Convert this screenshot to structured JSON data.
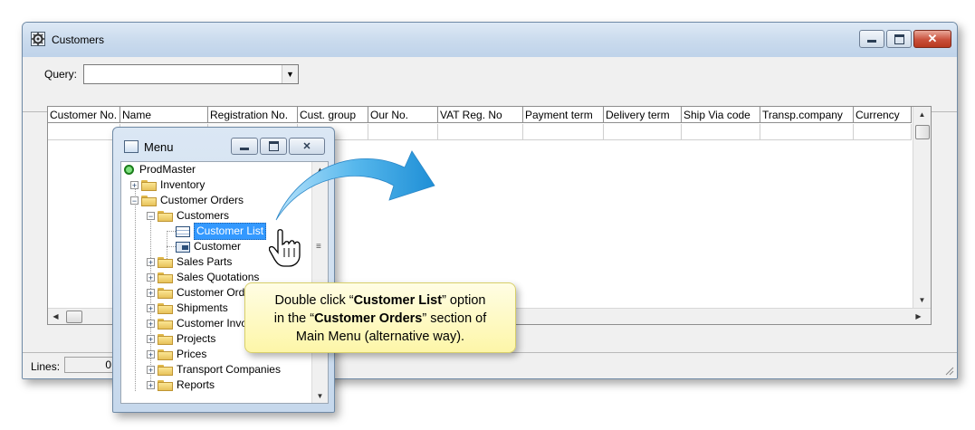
{
  "main_window": {
    "title": "Customers",
    "query_label": "Query:",
    "query_value": "",
    "columns": [
      "Customer No.",
      "Name",
      "Registration No.",
      "Cust. group",
      "Our No.",
      "VAT Reg. No",
      "Payment term",
      "Delivery term",
      "Ship Via code",
      "Transp.company",
      "Currency"
    ],
    "status": {
      "lines_label": "Lines:",
      "lines_value": "0"
    }
  },
  "menu_window": {
    "title": "Menu",
    "tree": {
      "root": "ProdMaster",
      "inventory": "Inventory",
      "customer_orders": "Customer Orders",
      "customers": "Customers",
      "customer_list": "Customer List",
      "customer": "Customer",
      "sales_parts": "Sales Parts",
      "sales_quotations": "Sales Quotations",
      "customer_orders_child": "Customer Orders",
      "shipments": "Shipments",
      "customer_invoices": "Customer Invoices",
      "projects": "Projects",
      "prices": "Prices",
      "transport_companies": "Transport Companies",
      "reports": "Reports"
    }
  },
  "callout": {
    "part1": "Double click “",
    "bold1": "Customer List",
    "part2": "” option",
    "part3": "in the “",
    "bold2": "Customer Orders",
    "part4": "” section of",
    "line3": "Main Menu (alternative way)."
  },
  "colors": {
    "titlebar": "#c9daed",
    "selection": "#3399ff",
    "callout_bg": "#fdf6a8",
    "arrow": "#2f9fe0",
    "close_button": "#c9503b"
  },
  "icons": [
    "app-gear-icon",
    "minimize-icon",
    "maximize-icon",
    "close-icon",
    "combo-dropdown-icon",
    "folder-icon",
    "list-doc-icon",
    "form-icon",
    "hand-cursor-icon",
    "curved-arrow-icon",
    "resize-grip-icon"
  ]
}
